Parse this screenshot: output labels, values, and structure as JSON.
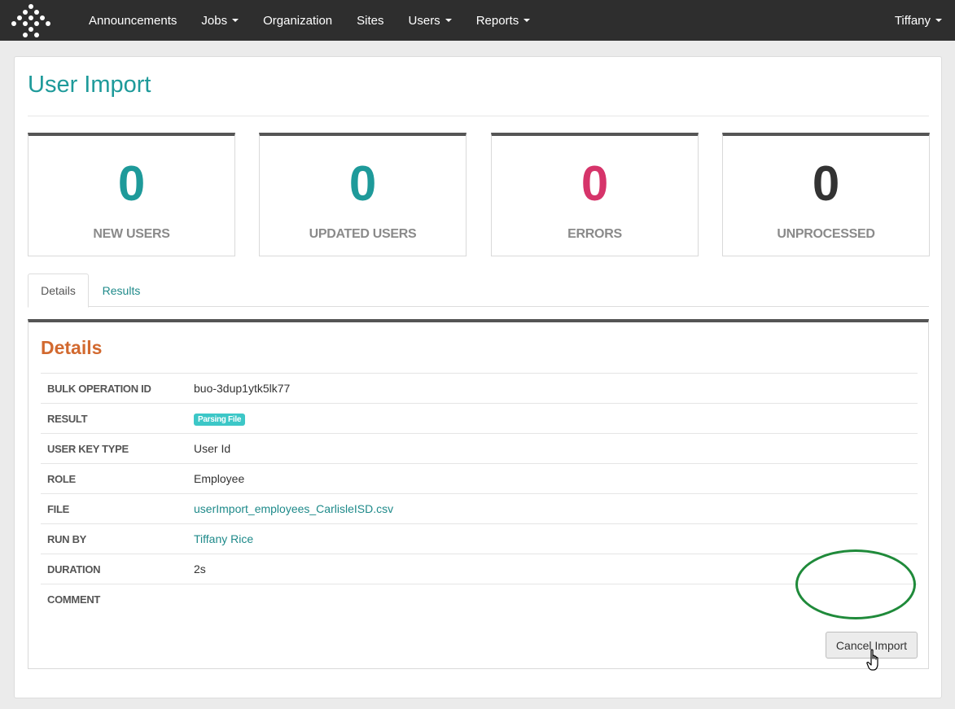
{
  "navbar": {
    "items": [
      {
        "label": "Announcements",
        "dropdown": false
      },
      {
        "label": "Jobs",
        "dropdown": true
      },
      {
        "label": "Organization",
        "dropdown": false
      },
      {
        "label": "Sites",
        "dropdown": false
      },
      {
        "label": "Users",
        "dropdown": true
      },
      {
        "label": "Reports",
        "dropdown": true
      }
    ],
    "user": "Tiffany"
  },
  "page": {
    "title": "User Import"
  },
  "stats": [
    {
      "value": "0",
      "label": "NEW USERS",
      "color": "#1e9a9a"
    },
    {
      "value": "0",
      "label": "UPDATED USERS",
      "color": "#1e9a9a"
    },
    {
      "value": "0",
      "label": "ERRORS",
      "color": "#d6346a"
    },
    {
      "value": "0",
      "label": "UNPROCESSED",
      "color": "#333333"
    }
  ],
  "tabs": {
    "details": "Details",
    "results": "Results"
  },
  "details": {
    "heading": "Details",
    "rows": [
      {
        "label": "BULK OPERATION ID",
        "value": "buo-3dup1ytk5lk77"
      },
      {
        "label": "RESULT",
        "badge": "Parsing File"
      },
      {
        "label": "USER KEY TYPE",
        "value": "User Id"
      },
      {
        "label": "ROLE",
        "value": "Employee"
      },
      {
        "label": "FILE",
        "value": "userImport_employees_CarlisleISD.csv"
      },
      {
        "label": "RUN BY",
        "value": "Tiffany Rice"
      },
      {
        "label": "DURATION",
        "value": "2s"
      },
      {
        "label": "COMMENT",
        "value": ""
      }
    ],
    "cancel_label": "Cancel Import"
  },
  "colors": {
    "accent": "#1e9a9a",
    "error": "#d6346a",
    "heading_orange": "#d2692f",
    "badge": "#3cc7c7",
    "navbar": "#2e2e2e",
    "highlight": "#1f8a3a"
  },
  "icons": {
    "logo": "dots-diamond-logo",
    "cursor": "hand-pointer-cursor"
  }
}
